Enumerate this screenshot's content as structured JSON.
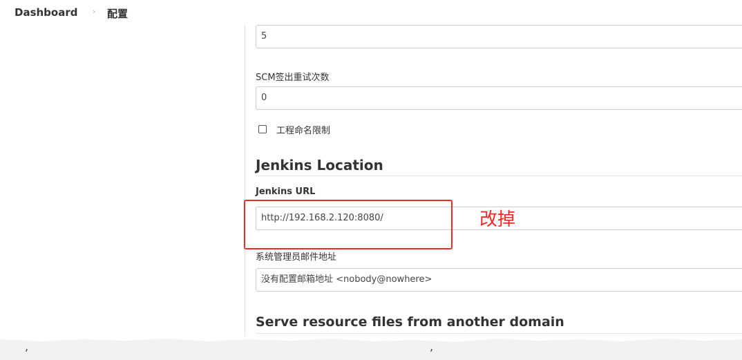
{
  "breadcrumb": {
    "home": "Dashboard",
    "separator": "›",
    "current": "配置"
  },
  "fields": {
    "top_value": "5",
    "scm_retry_label": "SCM签出重试次数",
    "scm_retry_value": "0",
    "project_naming_label": "工程命名限制",
    "project_naming_checked": false
  },
  "jenkins_location": {
    "heading": "Jenkins Location",
    "url_label": "Jenkins URL",
    "url_value": "http://192.168.2.120:8080/",
    "admin_email_label": "系统管理员邮件地址",
    "admin_email_value": "没有配置邮箱地址 <nobody@nowhere>"
  },
  "next_section": {
    "heading": "Serve resource files from another domain"
  },
  "annotation": {
    "text": "改掉",
    "color": "#ee2a24"
  }
}
